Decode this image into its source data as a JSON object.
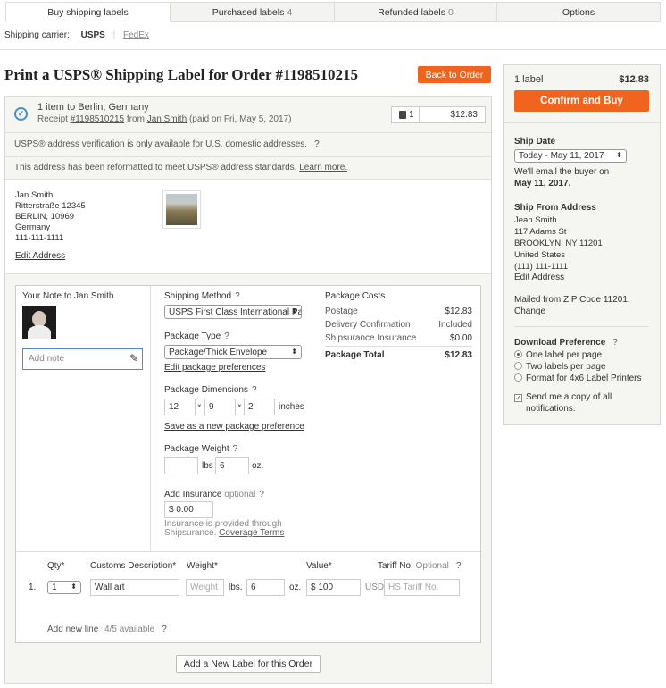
{
  "tabs": [
    {
      "label": "Buy shipping labels",
      "count": ""
    },
    {
      "label": "Purchased labels",
      "count": "4"
    },
    {
      "label": "Refunded labels",
      "count": "0"
    },
    {
      "label": "Options",
      "count": ""
    }
  ],
  "carrier": {
    "label": "Shipping carrier:",
    "usps": "USPS",
    "fedex": "FedEx"
  },
  "page_title": "Print a USPS® Shipping Label for Order #1198510215",
  "back_button": "Back to Order",
  "order": {
    "summary": "1 item to Berlin, Germany",
    "receipt_prefix": "Receipt",
    "receipt_number": "#1198510215",
    "receipt_from": "from",
    "buyer_link": "Jan Smith",
    "paid_on": "(paid on Fri, May 5, 2017)",
    "label_count": "1",
    "label_price": "$12.83"
  },
  "notices": {
    "verification": "USPS® address verification is only available for U.S. domestic addresses.",
    "reformatted": "This address has been reformatted to meet USPS® address standards.",
    "learn_more": "Learn more."
  },
  "address": {
    "lines": [
      "Jan Smith",
      "Ritterstraße 12345",
      "BERLIN, 10969",
      "Germany",
      "111-111-1111"
    ],
    "edit": "Edit Address"
  },
  "note": {
    "title": "Your Note to Jan Smith",
    "placeholder": "Add note"
  },
  "shipping_method": {
    "label": "Shipping Method",
    "value": "USPS First Class International Pa"
  },
  "package_type": {
    "label": "Package Type",
    "value": "Package/Thick Envelope",
    "edit": "Edit package preferences"
  },
  "dimensions": {
    "label": "Package Dimensions",
    "l": "12",
    "w": "9",
    "h": "2",
    "sep": "×",
    "unit": "inches",
    "save": "Save as a new package preference"
  },
  "weight": {
    "label": "Package Weight",
    "lbs": "",
    "lbs_unit": "lbs",
    "oz": "6",
    "oz_unit": "oz."
  },
  "insurance": {
    "label": "Add Insurance",
    "optional": "optional",
    "value": "$ 0.00",
    "note1": "Insurance is provided through",
    "note2": "Shipsurance.",
    "terms": "Coverage Terms"
  },
  "costs": {
    "title": "Package Costs",
    "rows": [
      {
        "label": "Postage",
        "value": "$12.83"
      },
      {
        "label": "Delivery Confirmation",
        "value": "Included"
      },
      {
        "label": "Shipsurance Insurance",
        "value": "$0.00"
      }
    ],
    "total_label": "Package Total",
    "total_value": "$12.83"
  },
  "customs": {
    "headers": {
      "qty": "Qty*",
      "desc": "Customs Description*",
      "weight": "Weight*",
      "value": "Value*",
      "tariff": "Tariff No.",
      "optional": "Optional"
    },
    "row": {
      "num": "1.",
      "qty": "1",
      "desc": "Wall art",
      "weight_placeholder": "Weight",
      "lbs": "lbs.",
      "oz": "6",
      "oz_unit": "oz.",
      "value": "$ 100",
      "currency": "USD",
      "tariff_placeholder": "HS Tariff No."
    },
    "add_line": "Add new line",
    "available": "4/5 available"
  },
  "add_label_button": "Add a New Label for this Order",
  "sidebar": {
    "label_count": "1 label",
    "total": "$12.83",
    "confirm": "Confirm and Buy",
    "ship_date_label": "Ship Date",
    "ship_date_value": "Today - May 11, 2017",
    "email_note": "We'll email the buyer on",
    "email_date": "May 11, 2017.",
    "from_label": "Ship From Address",
    "from_lines": [
      "Jean Smith",
      "117 Adams St",
      "BROOKLYN, NY 11201",
      "United States",
      "(111) 111-1111"
    ],
    "from_edit": "Edit Address",
    "mailed_from": "Mailed from ZIP Code 11201.",
    "change": "Change",
    "download_label": "Download Preference",
    "options": [
      "One label per page",
      "Two labels per page",
      "Format for 4x6 Label Printers"
    ],
    "send_copy_1": "Send me a copy of all",
    "send_copy_2": "notifications."
  },
  "colors": {
    "accent": "#f1641e",
    "check_blue": "#4a90c8"
  }
}
